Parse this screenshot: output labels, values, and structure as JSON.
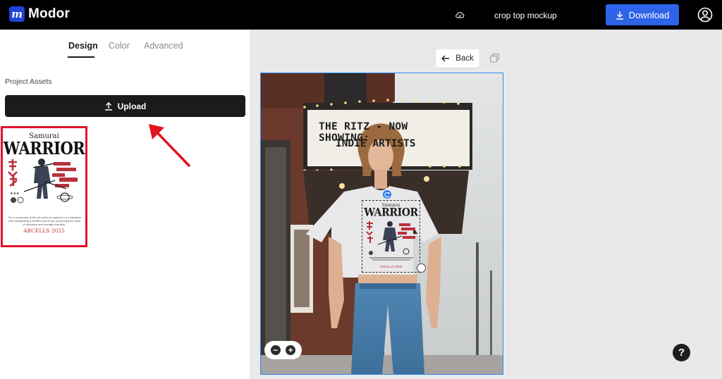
{
  "header": {
    "app_name": "Modor",
    "logo_letter": "m",
    "project_name": "crop top mockup",
    "download_label": "Download",
    "cloud_icon": "cloud-sync-icon",
    "account_icon": "user-circle-icon"
  },
  "left_panel": {
    "tabs": [
      {
        "label": "Design",
        "active": true
      },
      {
        "label": "Color",
        "active": false
      },
      {
        "label": "Advanced",
        "active": false
      }
    ],
    "assets_label": "Project Assets",
    "upload_label": "Upload",
    "asset": {
      "title_small": "Samurai",
      "title_big": "WARRIOR",
      "caption": "\"He is a samurai at the sib holds an capture a a a assassin with outstanding a fortified and shout, preserving the spirit of discipline and strength intensity\"",
      "footer": "ARCELLS 2025"
    }
  },
  "canvas": {
    "back_label": "Back",
    "sign_line1": "THE RITZ - NOW SHOWING:",
    "sign_line2": "INDIE ARTISTS",
    "print": {
      "title_small": "Samurai",
      "title_big": "WARRIOR",
      "footer": "ARCELLS 2025"
    },
    "zoom_out_label": "−",
    "zoom_in_label": "+"
  },
  "help_label": "?",
  "colors": {
    "accent": "#2f63e8",
    "highlight": "#e3132b",
    "selection": "#2a8bf2"
  }
}
